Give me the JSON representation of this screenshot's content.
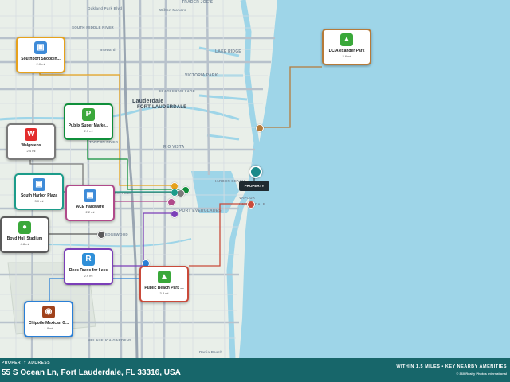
{
  "map": {
    "labels": [
      "TRADER JOE'S",
      "FORT LAUDERDALE",
      "LAKE RIDGE",
      "VICTORIA PARK",
      "Lauderdale",
      "FLAGLER VILLAGE",
      "SOUTH MIDDLE RIVER",
      "RIO VISTA",
      "PORT EVERGLADES",
      "HARBOR BEACH",
      "TARPON RIVER",
      "EDGEWOOD",
      "MELALEUCA GARDENS",
      "VAPOUR",
      "LAUDERDALE",
      "Oakland Park Blvd",
      "South Harbor Plaza",
      "Dania Beach",
      "Broward",
      "Wilton Manors"
    ],
    "ocean_color": "#9ed5e8",
    "land_color": "#e9efe9",
    "property": {
      "label": "PROPERTY"
    }
  },
  "pois": [
    {
      "name": "Southport Shoppin...",
      "distance": "2.0 mi",
      "icon": "shopping-bag-icon",
      "color": "#e6a21c",
      "icon_color": "#3e8bd8"
    },
    {
      "name": "Publix Super Marke...",
      "distance": "2.3 mi",
      "icon": "publix-icon",
      "color": "#0f8f3a",
      "icon_color": "#3aa83a"
    },
    {
      "name": "Walgreens",
      "distance": "2.4 mi",
      "icon": "walgreens-icon",
      "color": "#7a7a7a",
      "icon_color": "#e32c2c"
    },
    {
      "name": "South Harbor Plaza",
      "distance": "3.0 mi",
      "icon": "shopping-bag-icon",
      "color": "#1c9c8a",
      "icon_color": "#3e8bd8"
    },
    {
      "name": "ACE Hardware",
      "distance": "2.2 mi",
      "icon": "shopping-bag-icon",
      "color": "#b04a8a",
      "icon_color": "#3e8bd8"
    },
    {
      "name": "Boyd Hull Stadium",
      "distance": "4.8 mi",
      "icon": "stadium-icon",
      "color": "#5a5a5a",
      "icon_color": "#3aa83a"
    },
    {
      "name": "Ross Dress for Less",
      "distance": "2.9 mi",
      "icon": "ross-icon",
      "color": "#7b3fb8",
      "icon_color": "#2f8fd8"
    },
    {
      "name": "Public Beach Park ...",
      "distance": "3.3 mi",
      "icon": "tree-icon",
      "color": "#c94a3a",
      "icon_color": "#3aa83a"
    },
    {
      "name": "Chipotle Mexican G...",
      "distance": "1.8 mi",
      "icon": "chipotle-icon",
      "color": "#2a7fd6",
      "icon_color": "#a0421c"
    },
    {
      "name": "DC Alexander Park",
      "distance": "2.6 mi",
      "icon": "tree-icon",
      "color": "#b57a3a",
      "icon_color": "#3aa83a"
    }
  ],
  "footer": {
    "address_label": "PROPERTY ADDRESS",
    "address": "55 S Ocean Ln, Fort Lauderdale, FL 33316, USA",
    "tagline": "WITHIN 1.5 MILES • KEY NEARBY AMENITIES",
    "credit": "© 360 Realty Photos International"
  }
}
